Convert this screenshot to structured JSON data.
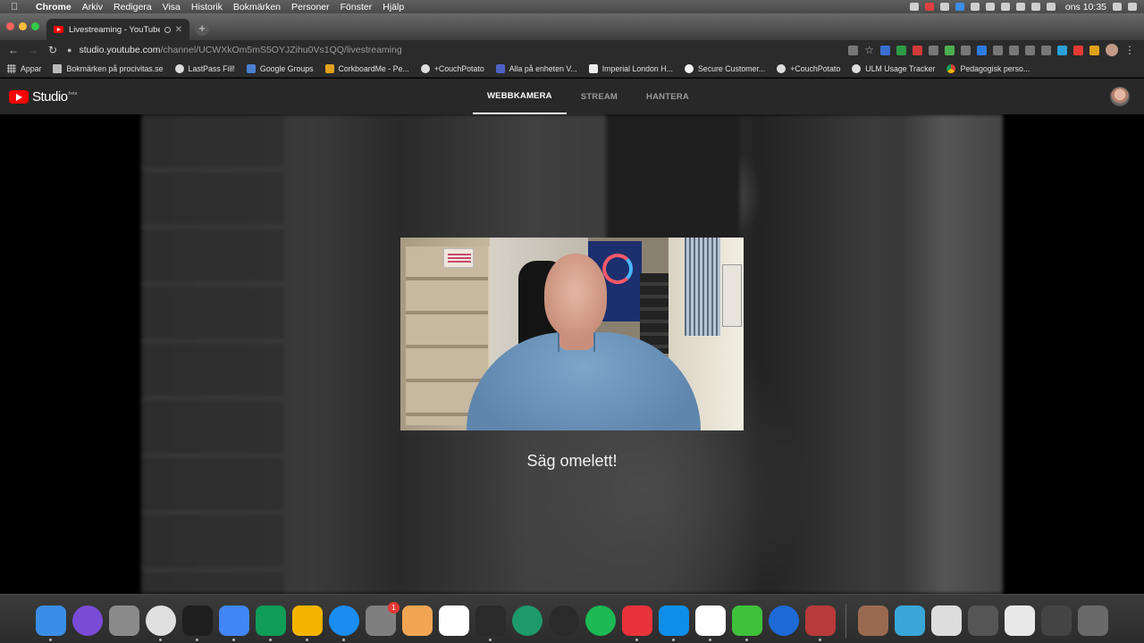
{
  "menubar": {
    "app": "Chrome",
    "items": [
      "Arkiv",
      "Redigera",
      "Visa",
      "Historik",
      "Bokmärken",
      "Personer",
      "Fönster",
      "Hjälp"
    ],
    "clock": "ons 10:35"
  },
  "browser": {
    "tab_title": "Livestreaming - YouTube S",
    "url_host": "studio.youtube.com",
    "url_path": "/channel/UCWXkOm5mS5OYJZihu0Vs1QQ/livestreaming"
  },
  "bookmarks": [
    {
      "label": "Appar",
      "icon": "apps-grid-icon"
    },
    {
      "label": "Bokmärken på procivitas.se",
      "icon": "folder-icon"
    },
    {
      "label": "LastPass Fill!",
      "icon": "couchpotato-icon"
    },
    {
      "label": "Google Groups",
      "icon": "google-groups-icon"
    },
    {
      "label": "CorkboardMe - Pe...",
      "icon": "corkboard-icon"
    },
    {
      "label": "+CouchPotato",
      "icon": "couchpotato-icon"
    },
    {
      "label": "Alla på enheten V...",
      "icon": "device-icon"
    },
    {
      "label": "Imperial London H...",
      "icon": "hotel-icon"
    },
    {
      "label": "Secure Customer...",
      "icon": "secure-icon"
    },
    {
      "label": "+CouchPotato",
      "icon": "couchpotato-icon"
    },
    {
      "label": "ULM Usage Tracker",
      "icon": "couchpotato-icon"
    },
    {
      "label": "Pedagogisk perso...",
      "icon": "chrome-icon"
    }
  ],
  "studio": {
    "logo_text": "Studio",
    "logo_badge": "beta",
    "tabs": [
      {
        "label": "WEBBKAMERA",
        "active": true
      },
      {
        "label": "STREAM",
        "active": false
      },
      {
        "label": "HANTERA",
        "active": false
      }
    ],
    "webcam_caption": "Säg omelett!"
  },
  "dock": [
    {
      "name": "finder-icon",
      "color": "#3a8ee6"
    },
    {
      "name": "siri-icon",
      "color": "#7a4bd6"
    },
    {
      "name": "launchpad-icon",
      "color": "#8a8a8a"
    },
    {
      "name": "chrome-icon",
      "color": "#e0e0e0"
    },
    {
      "name": "terminal-icon",
      "color": "#1e1e1e"
    },
    {
      "name": "google-docs-icon",
      "color": "#4285f4"
    },
    {
      "name": "google-sheets-icon",
      "color": "#0f9d58"
    },
    {
      "name": "google-slides-icon",
      "color": "#f4b400"
    },
    {
      "name": "app-store-icon",
      "color": "#1b8df2"
    },
    {
      "name": "system-preferences-icon",
      "color": "#7f7f7f",
      "badge": "1"
    },
    {
      "name": "fusion-360-icon",
      "color": "#f2a654"
    },
    {
      "name": "slack-icon",
      "color": "#ffffff"
    },
    {
      "name": "acrobat-icon",
      "color": "#2a2a2a"
    },
    {
      "name": "airmail-icon",
      "color": "#1d9a6c"
    },
    {
      "name": "wordpress-icon",
      "color": "#2a2a2a"
    },
    {
      "name": "spotify-icon",
      "color": "#1db954"
    },
    {
      "name": "remote-desktop-icon",
      "color": "#e8333a"
    },
    {
      "name": "teamviewer-icon",
      "color": "#0e8ee9"
    },
    {
      "name": "wunderlist-icon",
      "color": "#ffffff"
    },
    {
      "name": "camtasia-icon",
      "color": "#3ec13b"
    },
    {
      "name": "edge-icon",
      "color": "#1d6ad6"
    },
    {
      "name": "photo-booth-icon",
      "color": "#b83a3a"
    },
    {
      "name": "document-thumbnail-icon",
      "color": "#9a6a50"
    },
    {
      "name": "download-icon",
      "color": "#38a7d8"
    },
    {
      "name": "screenshot-thumbnail-icon",
      "color": "#dddddd"
    },
    {
      "name": "window-thumbnail-icon",
      "color": "#555555"
    },
    {
      "name": "chrome-window-thumbnail-icon",
      "color": "#e8e8e8"
    },
    {
      "name": "camtasia-window-thumbnail-icon",
      "color": "#444444"
    },
    {
      "name": "trash-icon",
      "color": "#6a6a6a"
    }
  ]
}
